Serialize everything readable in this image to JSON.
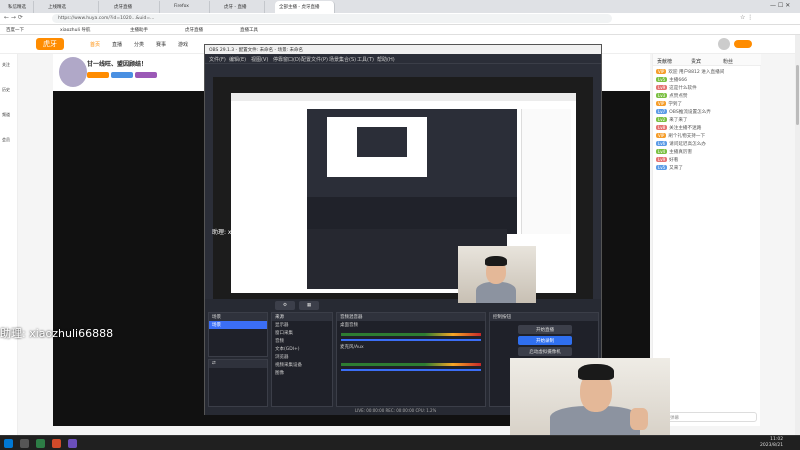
{
  "browser": {
    "tabs": [
      "私信精选",
      "上线精选",
      "虎牙直播",
      "Firefox",
      "虎牙 - 直播",
      "全部主播 - 虎牙直播"
    ],
    "url": "https://www.huya.com/?id=1020...&uid=...",
    "bookmarks": [
      "百度一下",
      "xiaozhuli 导航",
      "主播助手",
      "虎牙直播",
      "直播工具"
    ]
  },
  "site": {
    "logo": "虎牙",
    "nav": [
      "首页",
      "直播",
      "分类",
      "赛事",
      "游戏"
    ],
    "channel_title": "甘一线旺、盟因顾结！",
    "left_rail": [
      "关注",
      "历史",
      "频道",
      "会员"
    ]
  },
  "obs": {
    "title": "OBS 29.1.3 - 配置文件: 未命名 - 场景: 未命名",
    "menu": [
      "文件(F)",
      "编辑(E)",
      "视图(V)",
      "停靠窗口(D)",
      "配置文件(P)",
      "场景集合(S)",
      "工具(T)",
      "帮助(H)"
    ],
    "scenes_header": "场景",
    "scenes": [
      "场景"
    ],
    "sources_header": "来源",
    "sources": [
      "显示器",
      "窗口采集",
      "音频",
      "文本(GDI+)",
      "浏览器",
      "视频采集设备",
      "图像"
    ],
    "mixer_header": "音频混音器",
    "mixer": [
      "桌面音频",
      "麦克风/Aux"
    ],
    "controls_header": "控制按钮",
    "controls": [
      "开始直播",
      "开始录制",
      "启动虚拟摄像机",
      "工作室模式",
      "设置",
      "退出"
    ],
    "status": "LIVE: 00:00:00   REC: 00:00:00   CPU: 1.2%"
  },
  "chat": {
    "header": [
      "贡献榜",
      "贵宾",
      "粉丝"
    ],
    "lines": [
      "欢迎 用户8812 进入直播间",
      "主播666",
      "这是什么软件",
      "点赞点赞",
      "学到了",
      "OBS推流设置怎么弄",
      "来了来了",
      "关注主播不迷路",
      "刷个礼物支持一下",
      "请问延迟高怎么办",
      "主播真厉害",
      "好看",
      "又来了"
    ],
    "input_placeholder": "发送弹幕"
  },
  "watermark": "助理: xiaozhuli66888",
  "watermark_small": "助理: xiaozhuli66888",
  "taskbar": {
    "time": "11:02",
    "date": "2023/8/21"
  }
}
